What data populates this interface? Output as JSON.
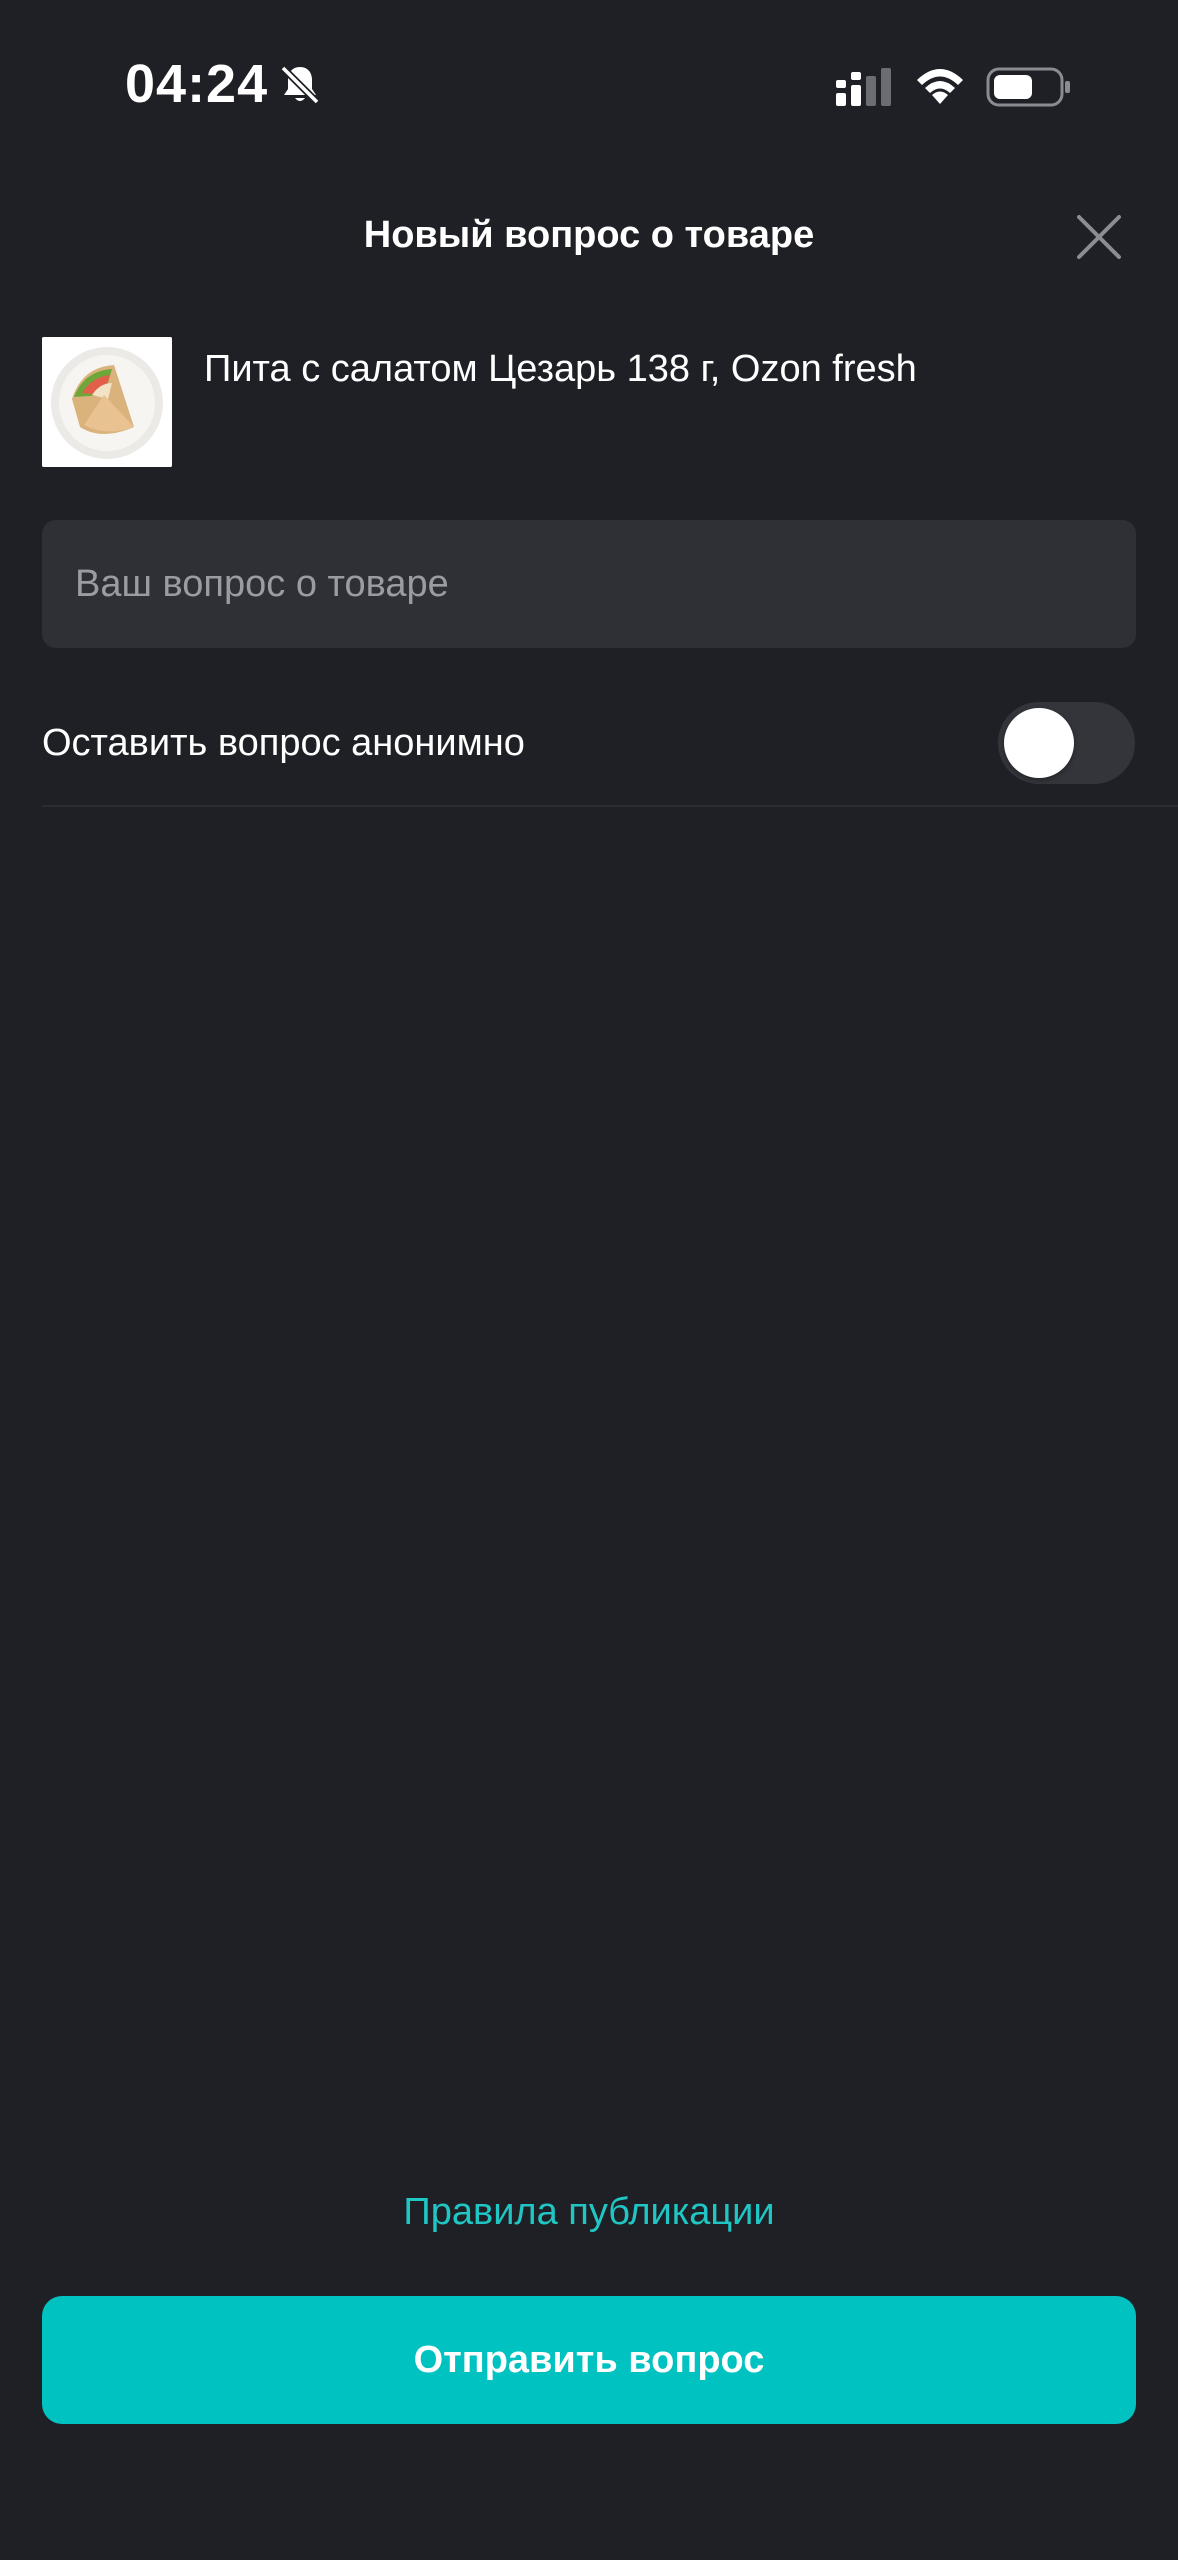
{
  "status_bar": {
    "time": "04:24",
    "icons": [
      "bell-off-icon",
      "cellular-signal-icon",
      "wifi-icon",
      "battery-icon"
    ]
  },
  "header": {
    "title": "Новый вопрос о товаре",
    "close_icon": "close-icon"
  },
  "product": {
    "name": "Пита с салатом Цезарь 138 г, Ozon fresh",
    "thumbnail_icon": "pita-sandwich-image"
  },
  "question": {
    "value": "",
    "placeholder": "Ваш вопрос о товаре"
  },
  "anonymous": {
    "label": "Оставить вопрос анонимно",
    "enabled": false
  },
  "footer": {
    "rules_link": "Правила публикации",
    "submit_label": "Отправить вопрос"
  },
  "colors": {
    "background": "#1e2025",
    "input_background": "#2f3036",
    "accent": "#00c2c1",
    "link": "#20c6c4",
    "toggle_off": "#33353b"
  }
}
